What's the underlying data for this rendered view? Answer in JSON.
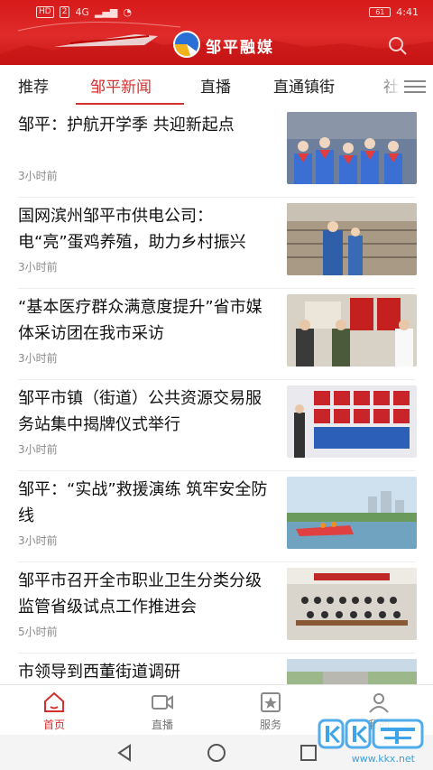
{
  "status_bar": {
    "left_badges": [
      "HD",
      "2",
      "4G"
    ],
    "battery": "61",
    "time": "4:41"
  },
  "header": {
    "brand": "邹平融媒"
  },
  "tabs": [
    "推荐",
    "邹平新闻",
    "直播",
    "直通镇街",
    "社"
  ],
  "active_tab": "邹平新闻",
  "news": [
    {
      "title": "邹平：护航开学季 共迎新起点",
      "time": "3小时前"
    },
    {
      "title": "国网滨州邹平市供电公司：电“亮”蛋鸡养殖，助力乡村振兴",
      "time": "3小时前"
    },
    {
      "title": "“基本医疗群众满意度提升”省市媒体采访团在我市采访",
      "time": "3小时前"
    },
    {
      "title": "邹平市镇（街道）公共资源交易服务站集中揭牌仪式举行",
      "time": "3小时前"
    },
    {
      "title": "邹平：“实战”救援演练 筑牢安全防线",
      "time": "3小时前"
    },
    {
      "title": "邹平市召开全市职业卫生分类分级监管省级试点工作推进会",
      "time": "5小时前"
    },
    {
      "title": "市领导到西董街道调研",
      "time": ""
    }
  ],
  "bottom_nav": [
    {
      "label": "首页",
      "icon": "home-icon",
      "active": true
    },
    {
      "label": "直播",
      "icon": "video-icon",
      "active": false
    },
    {
      "label": "服务",
      "icon": "star-box-icon",
      "active": false
    },
    {
      "label": "我的",
      "icon": "user-icon",
      "active": false
    }
  ],
  "watermark": {
    "text": "www.kkx.net"
  },
  "colors": {
    "accent": "#d43030",
    "header": "#d71a1a"
  }
}
